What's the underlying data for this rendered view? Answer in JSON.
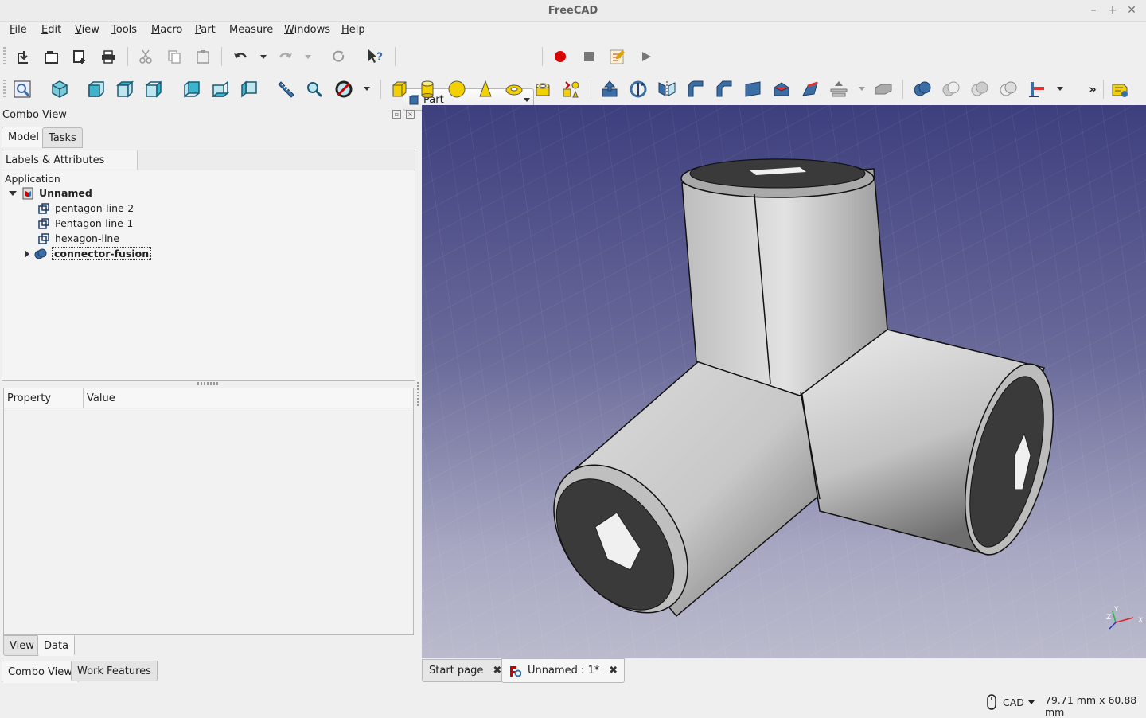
{
  "window": {
    "title": "FreeCAD",
    "controls": {
      "minimize": "–",
      "maximize": "+",
      "close": "✕"
    }
  },
  "menubar": {
    "items": [
      {
        "label": "File",
        "mnemonic": "F",
        "rest": "ile"
      },
      {
        "label": "Edit",
        "mnemonic": "E",
        "rest": "dit"
      },
      {
        "label": "View",
        "mnemonic": "V",
        "rest": "iew"
      },
      {
        "label": "Tools",
        "mnemonic": "T",
        "rest": "ools"
      },
      {
        "label": "Macro",
        "mnemonic": "M",
        "rest": "acro"
      },
      {
        "label": "Part",
        "mnemonic": "P",
        "rest": "art"
      },
      {
        "label": "Measure",
        "mnemonic": "",
        "rest": "Measure"
      },
      {
        "label": "Windows",
        "mnemonic": "W",
        "rest": "indows"
      },
      {
        "label": "Help",
        "mnemonic": "H",
        "rest": "elp"
      }
    ]
  },
  "toolbar": {
    "workbench_selected": "Part",
    "icons_row1": [
      "new-document-icon",
      "open-icon",
      "save-icon",
      "print-icon",
      "cut-icon",
      "copy-icon",
      "paste-icon",
      "undo-icon",
      "redo-icon",
      "refresh-icon",
      "whats-this-icon",
      "macro-record-icon",
      "macro-stop-icon",
      "macro-edit-icon",
      "macro-run-icon"
    ],
    "icons_row2": [
      "fit-all-icon",
      "isometric-view-icon",
      "front-view-icon",
      "top-view-icon",
      "right-view-icon",
      "rear-view-icon",
      "bottom-view-icon",
      "left-view-icon",
      "measure-distance-icon",
      "bounding-box-icon",
      "draw-style-icon",
      "box-primitive-icon",
      "cylinder-primitive-icon",
      "sphere-primitive-icon",
      "cone-primitive-icon",
      "torus-primitive-icon",
      "tube-primitive-icon",
      "primitives-icon",
      "extrude-icon",
      "revolve-icon",
      "mirror-icon",
      "fillet-icon",
      "chamfer-icon",
      "make-face-icon",
      "ruled-surface-icon",
      "loft-icon",
      "section-icon",
      "boolean-icon",
      "union-icon",
      "cut-boolean-icon",
      "intersection-icon",
      "join-icon",
      "more-tools-icon",
      "measure-linear-icon"
    ],
    "overflow_label": "»"
  },
  "combo_view": {
    "title": "Combo View",
    "tabs": [
      "Model",
      "Tasks"
    ],
    "active_tab": "Model",
    "tree_header": "Labels & Attributes",
    "tree": {
      "root_label": "Application",
      "document": "Unnamed",
      "items": [
        "pentagon-line-2",
        "Pentagon-line-1",
        "hexagon-line"
      ],
      "selected": "connector-fusion"
    },
    "property_headers": {
      "property": "Property",
      "value": "Value"
    },
    "property_tabs": [
      "View",
      "Data"
    ],
    "active_property_tab": "Data"
  },
  "bottom_dock_tabs": [
    "Combo View",
    "Work Features"
  ],
  "document_tabs": [
    {
      "label": "Start page"
    },
    {
      "label": "Unnamed : 1*"
    }
  ],
  "viewport": {
    "background_top": "#3d3f7e",
    "background_bottom": "#bbbbcd",
    "model": "3-way tube connector",
    "axis_labels": {
      "x": "X",
      "y": "Y",
      "z": "Z"
    }
  },
  "statusbar": {
    "navigation_style": "CAD",
    "dimensions": "79.71 mm x 60.88 mm"
  }
}
